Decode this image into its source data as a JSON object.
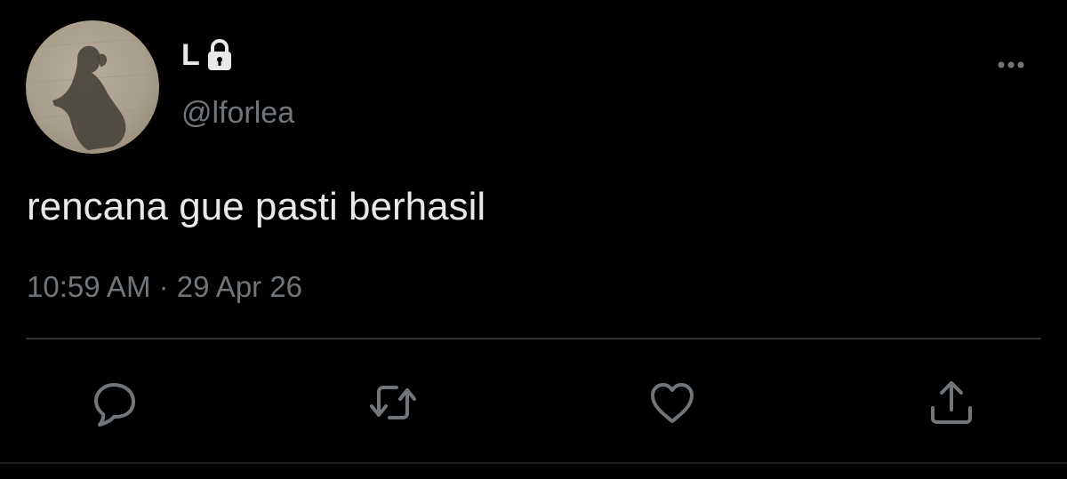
{
  "tweet": {
    "author": {
      "display_name": "L",
      "handle": "@lforlea",
      "avatar_icon": "avatar-silhouette",
      "protected_icon": "lock-icon"
    },
    "text": "rencana gue pasti berhasil",
    "timestamp": "10:59 AM · 29 Apr 26",
    "more_icon": "more-icon"
  },
  "actions": [
    {
      "icon": "reply-icon"
    },
    {
      "icon": "retweet-icon"
    },
    {
      "icon": "like-icon"
    },
    {
      "icon": "share-icon"
    }
  ],
  "colors": {
    "background": "#000000",
    "primary_text": "#e7e9ea",
    "secondary_text": "#71767b",
    "divider": "#2f3336"
  }
}
